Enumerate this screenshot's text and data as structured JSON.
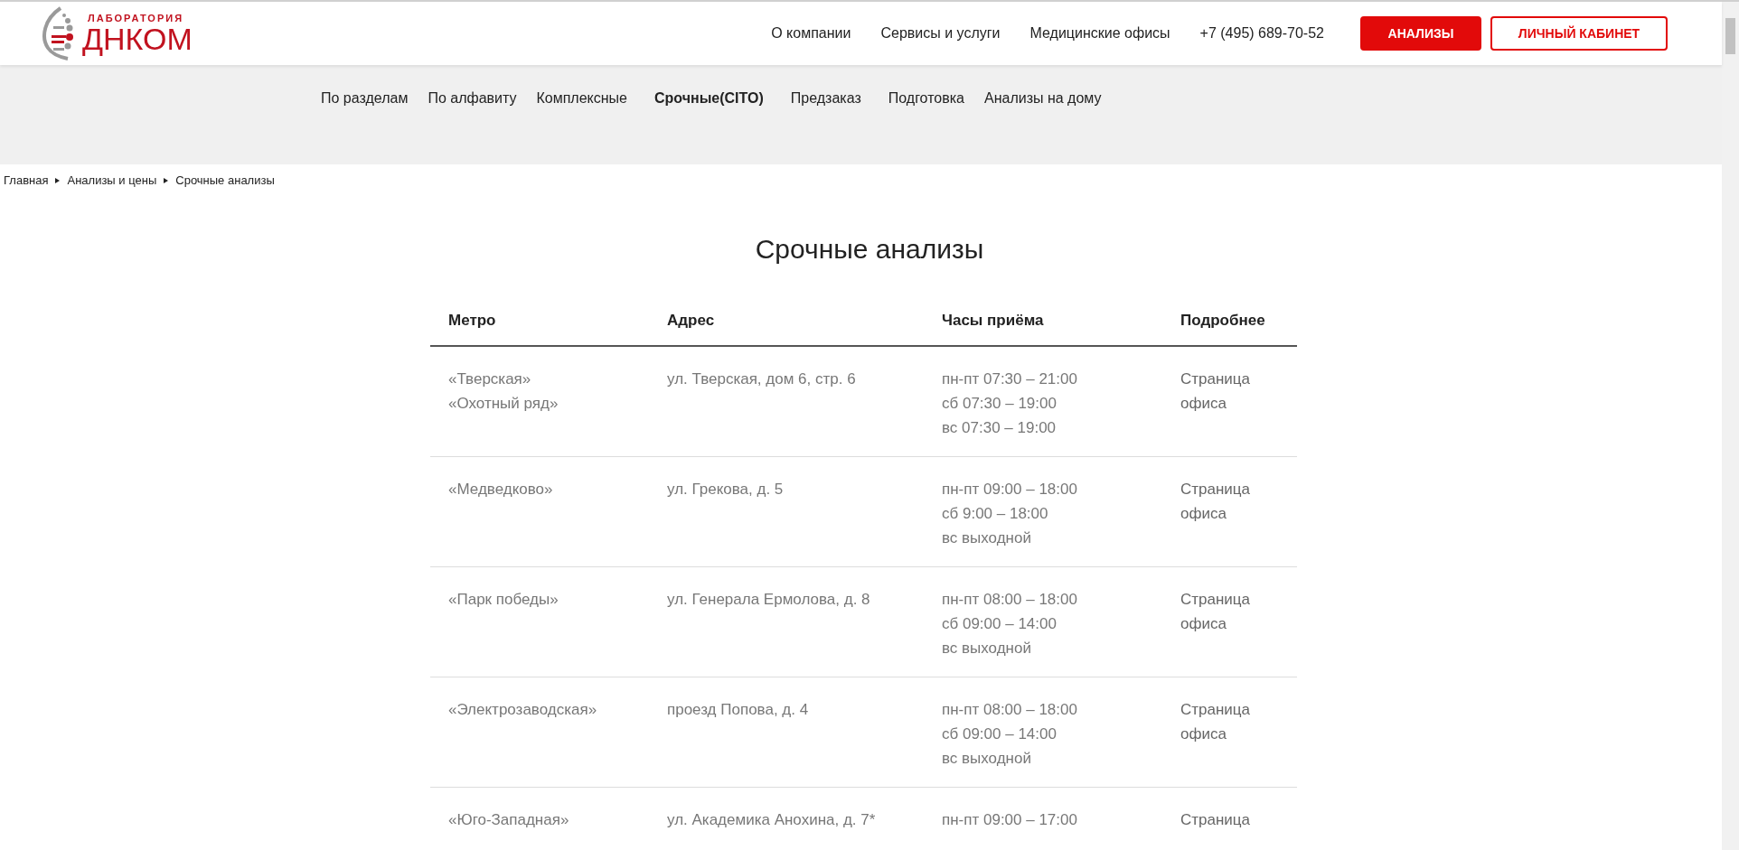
{
  "logo": {
    "caption": "ЛАБОРАТОРИЯ",
    "name": "ДНКОМ"
  },
  "main_nav": [
    "О компании",
    "Сервисы и услуги",
    "Медицинские офисы"
  ],
  "phone": "+7 (495) 689-70-52",
  "buttons": [
    {
      "label": "АНАЛИЗЫ",
      "kind": "primary"
    },
    {
      "label": "ЛИЧНЫЙ КАБИНЕТ",
      "kind": "outline"
    }
  ],
  "sub_nav": [
    {
      "label": "По разделам",
      "selected": false
    },
    {
      "label": "По алфавиту",
      "selected": false
    },
    {
      "label": "Комплексные",
      "selected": false
    },
    {
      "label": "Срочные(CITO)",
      "selected": true
    },
    {
      "label": "Предзаказ",
      "selected": false
    },
    {
      "label": "Подготовка",
      "selected": false
    },
    {
      "label": "Анализы на дому",
      "selected": false
    }
  ],
  "breadcrumbs": [
    "Главная",
    "Анализы и цены",
    "Срочные анализы"
  ],
  "title": "Срочные анализы",
  "table": {
    "columns": [
      "Метро",
      "Адрес",
      "Часы приёма",
      "Подробнее"
    ],
    "rows": [
      {
        "metro": [
          "«Тверская»",
          "«Охотный ряд»"
        ],
        "address": "ул. Тверская, дом 6, стр. 6",
        "hours": [
          "пн-пт 07:30 – 21:00",
          "сб 07:30 – 19:00",
          "вс 07:30 – 19:00"
        ],
        "link": [
          "Страница",
          "офиса"
        ]
      },
      {
        "metro": [
          "«Медведково»"
        ],
        "address": "ул. Грекова, д. 5",
        "hours": [
          "пн-пт 09:00 – 18:00",
          "сб 9:00 – 18:00",
          "вс выходной"
        ],
        "link": [
          "Страница",
          "офиса"
        ]
      },
      {
        "metro": [
          "«Парк победы»"
        ],
        "address": "ул. Генерала Ермолова, д. 8",
        "hours": [
          "пн-пт 08:00 – 18:00",
          "сб 09:00 – 14:00",
          "вс выходной"
        ],
        "link": [
          "Страница",
          "офиса"
        ]
      },
      {
        "metro": [
          "«Электрозаводская»"
        ],
        "address": "проезд Попова, д. 4",
        "hours": [
          "пн-пт 08:00 – 18:00",
          "сб 09:00 – 14:00",
          "вс выходной"
        ],
        "link": [
          "Страница",
          "офиса"
        ]
      },
      {
        "metro": [
          "«Юго-Западная»"
        ],
        "address": "ул. Академика Анохина, д. 7*",
        "hours": [
          "пн-пт 09:00 – 17:00"
        ],
        "link": [
          "Страница"
        ]
      }
    ]
  }
}
